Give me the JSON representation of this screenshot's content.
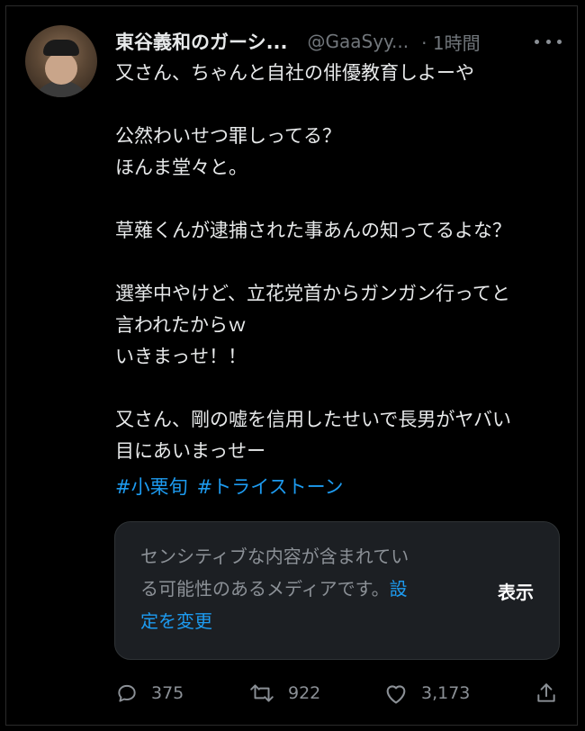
{
  "author": {
    "display_name": "東谷義和のガーシ...",
    "handle": "@GaaSyy...",
    "time": "· 1時間"
  },
  "tweet": {
    "lines": [
      "又さん、ちゃんと自社の俳優教育しよーや",
      "",
      "公然わいせつ罪しってる？",
      "ほんま堂々と。",
      "",
      "草薙くんが逮捕された事あんの知ってるよな？",
      "",
      "選挙中やけど、立花党首からガンガン行ってと",
      "言われたからｗ",
      "いきまっせ！！",
      "",
      "又さん、剛の嘘を信用したせいで長男がヤバい",
      "目にあいまっせー"
    ],
    "hashtags": [
      "#小栗旬",
      "#トライストーン"
    ]
  },
  "media_warning": {
    "text_line1": "センシティブな内容が含まれてい",
    "text_line2": "る可能性のあるメディアです。",
    "link_part1": "設",
    "link_part2": "定を変更",
    "show_label": "表示"
  },
  "actions": {
    "replies": "375",
    "retweets": "922",
    "likes": "3,173"
  },
  "icons": {
    "more": "more-horizontal-icon",
    "reply": "reply-icon",
    "retweet": "retweet-icon",
    "like": "heart-icon",
    "share": "share-icon"
  },
  "colors": {
    "background": "#000000",
    "text": "#e7e9ea",
    "secondary": "#71767b",
    "link": "#1d9bf0",
    "media_box": "#1c1f23"
  }
}
